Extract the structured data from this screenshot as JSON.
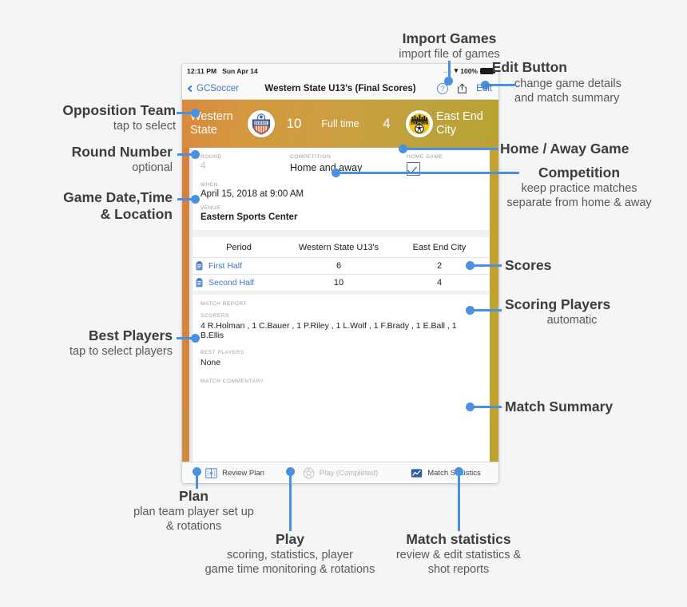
{
  "device": {
    "status_bar": {
      "time": "12:11 PM",
      "date": "Sun Apr 14",
      "dots": "....",
      "wifi_icon": "wifi-icon",
      "battery_pct": "100%"
    },
    "nav_bar": {
      "back_label": "GCSoccer",
      "title": "Western State U13's (Final Scores)",
      "help_label": "?",
      "share_icon": "share-icon",
      "edit_label": "Edit"
    },
    "scoreboard": {
      "away_team": "Western State",
      "away_crest": "western-state-crest",
      "away_score": "10",
      "status": "Full time",
      "home_score": "4",
      "home_crest": "east-end-city-crest",
      "home_team": "East End City",
      "gradient_from": "#d98a3e",
      "gradient_to": "#b9a231"
    },
    "details": {
      "round_label": "ROUND",
      "round_value": "4",
      "competition_label": "COMPETITION",
      "competition_value": "Home and away",
      "home_game_label": "HOME GAME",
      "home_game_checked": true,
      "when_label": "WHEN",
      "when_value": "April 15, 2018 at 9:00 AM",
      "venue_label": "VENUE",
      "venue_value": "Eastern Sports Center"
    },
    "period_table": {
      "headers": [
        "Period",
        "Western State U13's",
        "East End City"
      ],
      "rows": [
        {
          "icon": "clipboard-icon",
          "period": "First Half",
          "away": "6",
          "home": "2"
        },
        {
          "icon": "clipboard-icon",
          "period": "Second Half",
          "away": "10",
          "home": "4"
        }
      ]
    },
    "match_report": {
      "section_label": "MATCH REPORT",
      "scorers_label": "SCORERS",
      "scorers_value": "4 R.Holman , 1 C.Bauer , 1 P.Riley , 1 L.Wolf , 1 F.Brady , 1 E.Ball , 1 B.Ellis",
      "best_players_label": "BEST PLAYERS",
      "best_players_value": "None",
      "commentary_label": "MATCH COMMENTARY",
      "commentary_value": ""
    },
    "tab_bar": [
      {
        "icon": "plan-book-icon",
        "label": "Review Plan",
        "state": "enabled"
      },
      {
        "icon": "soccer-ball-icon",
        "label": "Play (Completed)",
        "state": "disabled"
      },
      {
        "icon": "chart-icon",
        "label": "Match Statistics",
        "state": "enabled"
      }
    ]
  },
  "annotations": {
    "import_games": {
      "title": "Import Games",
      "sub": "import file of games"
    },
    "edit_button": {
      "title": "Edit Button",
      "sub1": "change game details",
      "sub2": "and match summary"
    },
    "opposition_team": {
      "title": "Opposition Team",
      "sub": "tap to select"
    },
    "round_number": {
      "title": "Round Number",
      "sub": "optional"
    },
    "game_date": {
      "title1": "Game Date,Time",
      "title2": "& Location"
    },
    "best_players": {
      "title": "Best Players",
      "sub": "tap to select players"
    },
    "home_away": {
      "title": "Home / Away Game"
    },
    "competition": {
      "title": "Competition",
      "sub1": "keep practice matches",
      "sub2": "separate from home & away"
    },
    "scores": {
      "title": "Scores"
    },
    "scoring_players": {
      "title": "Scoring Players",
      "sub": "automatic"
    },
    "match_summary": {
      "title": "Match Summary"
    },
    "plan": {
      "title": "Plan",
      "sub1": "plan team player set up",
      "sub2": "& rotations"
    },
    "play": {
      "title": "Play",
      "sub1": "scoring, statistics, player",
      "sub2": "game time monitoring & rotations"
    },
    "match_statistics": {
      "title": "Match statistics",
      "sub1": "review & edit statistics &",
      "sub2": "shot reports"
    }
  },
  "colors": {
    "accent": "#4a90e2",
    "link": "#3d74c4",
    "orange": "#d4813c",
    "yellow": "#c2a32f"
  }
}
